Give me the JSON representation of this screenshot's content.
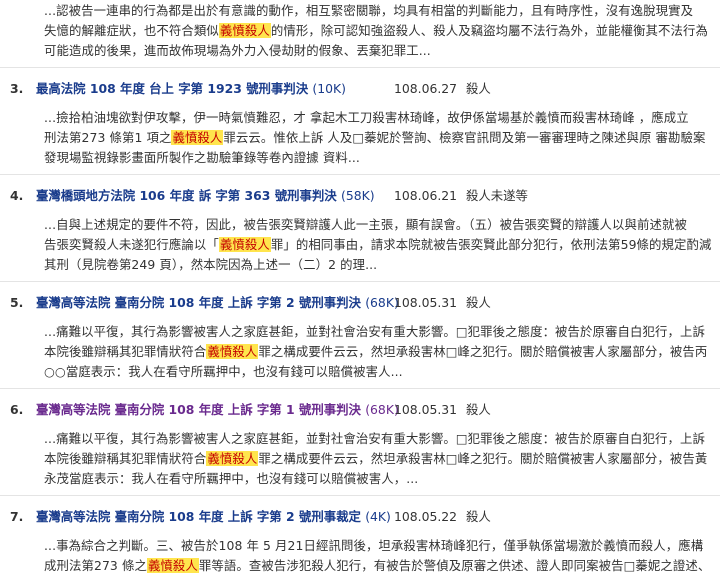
{
  "results": [
    {
      "snippet_lines": [
        [
          "...認被告一連串的行為都是出於有意識的動作，相互緊密關聯，均具有相當的判斷能力，且有時序性，沒有逸脫現實及"
        ],
        [
          "失憶的解離症狀，也不符合類似",
          {
            "hl": "義憤殺人"
          },
          "的情形，除可認知強盜殺人、殺人及竊盜均屬不法行為外，並能權衡其不法行為"
        ],
        [
          "可能造成的後果，進而故佈現場為外力入侵劫財的假象、丟棄犯罪工..."
        ]
      ]
    },
    {
      "num": "3.",
      "title": "最高法院 108 年度 台上 字第 1923 號刑事判決",
      "size": "(10K)",
      "date": "108.06.27",
      "cause": "殺人",
      "visited": false,
      "snippet_lines": [
        [
          "...撿拾柏油塊欲對伊攻擊，伊一時氣憤難忍，才 拿起木工刀殺害林琦峰，故伊係當場基於義憤而殺害林琦峰  ，應成立"
        ],
        [
          "刑法第273 條第1 項之",
          {
            "hl": "義憤殺人"
          },
          "罪云云。惟依上訴 人及□蓁妮於警詢、檢察官訊問及第一審審理時之陳述與原 審勘驗案"
        ],
        [
          "發現場監視錄影畫面所製作之勘驗筆錄等卷內證據 資料..."
        ]
      ]
    },
    {
      "num": "4.",
      "title": "臺灣橋頭地方法院 106 年度 訴 字第 363 號刑事判決",
      "size": "(58K)",
      "date": "108.06.21",
      "cause": "殺人未遂等",
      "visited": false,
      "snippet_lines": [
        [
          "...自與上述規定的要件不符，因此，被告張奕賢辯護人此一主張，顯有誤會。（五）被告張奕賢的辯護人以與前述就被"
        ],
        [
          "告張奕賢殺人未遂犯行應論以「",
          {
            "hl": "義憤殺人"
          },
          "罪」的相同事由，請求本院就被告張奕賢此部分犯行，依刑法第59條的規定酌減"
        ],
        [
          "其刑（見院卷第249 頁），然本院因為上述一（二）2 的理..."
        ]
      ]
    },
    {
      "num": "5.",
      "title": "臺灣高等法院 臺南分院 108 年度 上訴 字第 2 號刑事判決",
      "size": "(68K)",
      "date": "108.05.31",
      "cause": "殺人",
      "visited": false,
      "snippet_lines": [
        [
          "...痛難以平復，其行為影響被害人之家庭甚鉅，並對社會治安有重大影響。□犯罪後之態度：被告於原審自白犯行，上訴"
        ],
        [
          "本院後雖辯稱其犯罪情狀符合",
          {
            "hl": "義憤殺人"
          },
          "罪之構成要件云云，然坦承殺害林□峰之犯行。關於賠償被害人家屬部分，被告丙"
        ],
        [
          "○○當庭表示：我人在看守所羈押中，也沒有錢可以賠償被害人..."
        ]
      ]
    },
    {
      "num": "6.",
      "title": "臺灣高等法院 臺南分院 108 年度 上訴 字第 1 號刑事判決",
      "size": "(68K)",
      "date": "108.05.31",
      "cause": "殺人",
      "visited": true,
      "snippet_lines": [
        [
          "...痛難以平復，其行為影響被害人之家庭甚鉅，並對社會治安有重大影響。□犯罪後之態度：被告於原審自白犯行，上訴"
        ],
        [
          "本院後雖辯稱其犯罪情狀符合",
          {
            "hl": "義憤殺人"
          },
          "罪之構成要件云云，然坦承殺害林□峰之犯行。關於賠償被害人家屬部分，被告黃"
        ],
        [
          "永茂當庭表示：我人在看守所羈押中，也沒有錢可以賠償被害人，..."
        ]
      ]
    },
    {
      "num": "7.",
      "title": "臺灣高等法院 臺南分院 108 年度 上訴 字第 2 號刑事裁定",
      "size": "(4K)",
      "date": "108.05.22",
      "cause": "殺人",
      "visited": false,
      "snippet_lines": [
        [
          "...事為綜合之判斷。三、被告於108 年 5 月21日經訊問後，坦承殺害林琦峰犯行，僅爭執係當場激於義憤而殺人，應構"
        ],
        [
          "成刑法第273 條之",
          {
            "hl": "義憤殺人"
          },
          "罪等語。查被告涉犯殺人犯行，有被告於警偵及原審之供述、證人即同案被告□蓁妮之證述、"
        ]
      ]
    }
  ]
}
